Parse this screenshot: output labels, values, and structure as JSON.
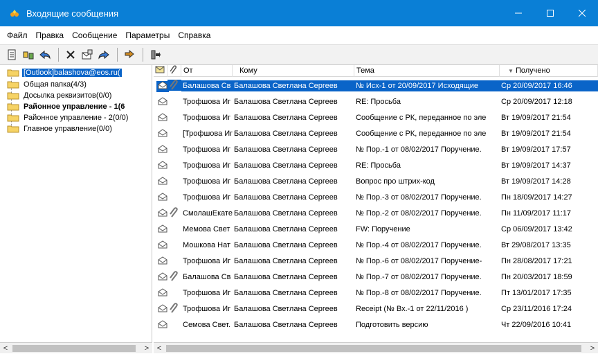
{
  "window": {
    "title": "Входящие сообщения"
  },
  "menu": [
    "Файл",
    "Правка",
    "Сообщение",
    "Параметры",
    "Справка"
  ],
  "tree": [
    {
      "label": "[Outlook]balashova@eos.ru(",
      "selected": true,
      "bold": false
    },
    {
      "label": "Общая папка(4/3)",
      "selected": false,
      "bold": false
    },
    {
      "label": "Досылка реквизитов(0/0)",
      "selected": false,
      "bold": false
    },
    {
      "label": "Районное управление - 1(6",
      "selected": false,
      "bold": true
    },
    {
      "label": "Районное управление - 2(0/0)",
      "selected": false,
      "bold": false
    },
    {
      "label": "Главное управление(0/0)",
      "selected": false,
      "bold": false
    }
  ],
  "columns": {
    "from": "От",
    "to": "Кому",
    "subject": "Тема",
    "received": "Получено"
  },
  "messages": [
    {
      "attach": true,
      "from": "Балашова Св",
      "to": "Балашова Светлана Сергеев",
      "subject": "№ Исх-1 от 20/09/2017 Исходящие",
      "received": "Ср 20/09/2017 16:46",
      "selected": true
    },
    {
      "attach": false,
      "from": "Трофшова Иг",
      "to": "Балашова Светлана Сергеев",
      "subject": "RE: Просьба",
      "received": "Ср 20/09/2017 12:18",
      "selected": false
    },
    {
      "attach": false,
      "from": "Трофшова Иг",
      "to": "Балашова Светлана Сергеев",
      "subject": "Сообщение с РК, переданное по эле",
      "received": "Вт 19/09/2017 21:54",
      "selected": false
    },
    {
      "attach": false,
      "from": "[Трофшова Иг",
      "to": "Балашова Светлана Сергеев",
      "subject": "Сообщение с РК, переданное по эле",
      "received": "Вт 19/09/2017 21:54",
      "selected": false
    },
    {
      "attach": false,
      "from": "Трофшова Иг",
      "to": "Балашова Светлана Сергеев",
      "subject": "№ Пор.-1 от 08/02/2017 Поручение.",
      "received": "Вт 19/09/2017 17:57",
      "selected": false
    },
    {
      "attach": false,
      "from": "Трофшова Иг",
      "to": "Балашова Светлана Сергеев",
      "subject": "RE: Просьба",
      "received": "Вт 19/09/2017 14:37",
      "selected": false
    },
    {
      "attach": false,
      "from": "Трофшова Иг",
      "to": "Балашова Светлана Сергеев",
      "subject": "Вопрос про штрих-код",
      "received": "Вт 19/09/2017 14:28",
      "selected": false
    },
    {
      "attach": false,
      "from": "Трофшова Иг",
      "to": "Балашова Светлана Сергеев",
      "subject": "№ Пор.-3 от 08/02/2017 Поручение.",
      "received": "Пн 18/09/2017 14:27",
      "selected": false
    },
    {
      "attach": true,
      "from": "СмолашЕкате",
      "to": "Балашова Светлана Сергеев",
      "subject": "№ Пор.-2 от 08/02/2017 Поручение.",
      "received": "Пн 11/09/2017 11:17",
      "selected": false
    },
    {
      "attach": false,
      "from": "Мемова Свет",
      "to": "Балашова Светлана Сергеев",
      "subject": "FW: Поручение",
      "received": "Ср 06/09/2017 13:42",
      "selected": false
    },
    {
      "attach": false,
      "from": "Мошкова Нат",
      "to": "Балашова Светлана Сергеев",
      "subject": "№ Пор.-4 от 08/02/2017 Поручение.",
      "received": "Вт 29/08/2017 13:35",
      "selected": false
    },
    {
      "attach": false,
      "from": "Трофшова Иг",
      "to": "Балашова Светлана Сергеев",
      "subject": "№ Пор.-6 от 08/02/2017 Поручение-",
      "received": "Пн 28/08/2017 17:21",
      "selected": false
    },
    {
      "attach": true,
      "from": "Балашова Св",
      "to": "Балашова Светлана Сергеев",
      "subject": "№ Пор.-7 от 08/02/2017 Поручение.",
      "received": "Пн 20/03/2017 18:59",
      "selected": false
    },
    {
      "attach": false,
      "from": "Трофшова Иг",
      "to": "Балашова Светлана Сергеев",
      "subject": "№ Пор.-8 от 08/02/2017 Поручение.",
      "received": "Пт 13/01/2017 17:35",
      "selected": false
    },
    {
      "attach": true,
      "from": "Трофшова Иг",
      "to": "Балашова Светлана Сергеев",
      "subject": "Receipt (№ Вх.-1 от 22/11/2016 )",
      "received": "Ср 23/11/2016 17:24",
      "selected": false
    },
    {
      "attach": false,
      "from": "Семова Свет.",
      "to": "Балашова Светлана Сергеев",
      "subject": "Подготовить версию",
      "received": "Чт 22/09/2016 10:41",
      "selected": false
    }
  ],
  "colors": {
    "titlebar": "#0a7fd6",
    "selection": "#0a64c8"
  }
}
